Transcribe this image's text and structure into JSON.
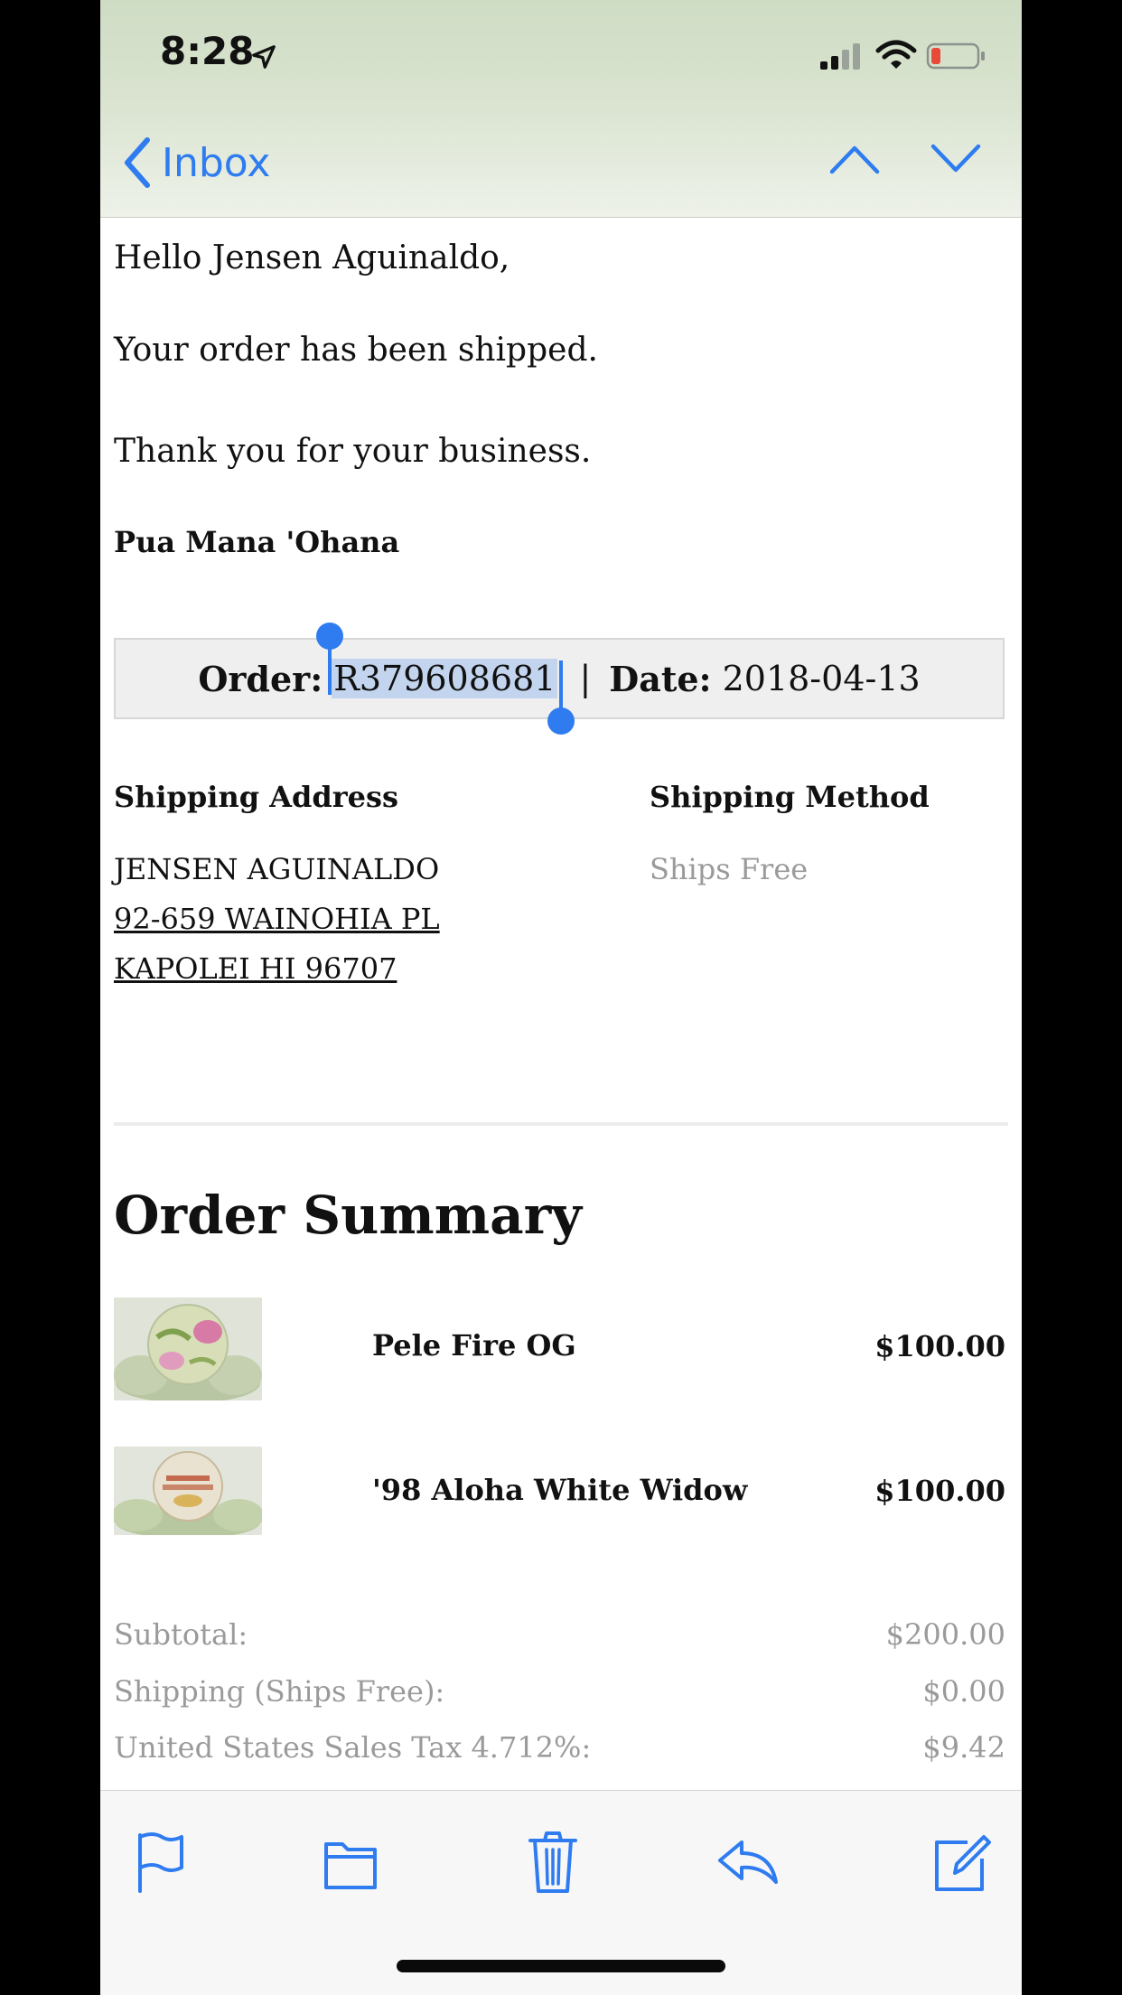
{
  "status_bar": {
    "time": "8:28",
    "icons": [
      "location-arrow-icon",
      "cellular-signal-icon",
      "wifi-icon",
      "battery-low-icon"
    ],
    "battery_color": "#e84a3a"
  },
  "nav": {
    "back_label": "Inbox",
    "accent": "#2f7cf0"
  },
  "email": {
    "greeting": "Hello Jensen Aguinaldo,",
    "shipped": "Your order has been shipped.",
    "thanks": "Thank you for your business.",
    "signature": "Pua Mana 'Ohana",
    "order": {
      "order_label": "Order:",
      "order_number": "R379608681",
      "separator": "|",
      "date_label": "Date:",
      "date": "2018-04-13"
    },
    "shipping_address_heading": "Shipping Address",
    "shipping_method_heading": "Shipping Method",
    "address": {
      "name": "JENSEN AGUINALDO",
      "line1": "92-659 WAINOHIA PL",
      "line2": "KAPOLEI HI 96707"
    },
    "shipping_method": "Ships Free",
    "summary_heading": "Order Summary",
    "items": [
      {
        "name": "Pele Fire OG",
        "price": "$100.00"
      },
      {
        "name": "'98 Aloha White Widow",
        "price": "$100.00"
      }
    ],
    "totals": [
      {
        "label": "Subtotal:",
        "value": "$200.00"
      },
      {
        "label": "Shipping (Ships Free):",
        "value": "$0.00"
      },
      {
        "label": "United States Sales Tax 4.712%:",
        "value": "$9.42"
      }
    ]
  },
  "toolbar": {
    "icons": [
      "flag-icon",
      "folder-icon",
      "trash-icon",
      "reply-icon",
      "compose-icon"
    ]
  }
}
